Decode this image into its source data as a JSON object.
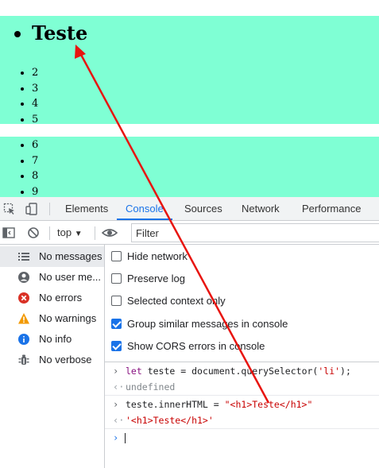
{
  "page": {
    "list1": {
      "big_item": "Teste",
      "items": [
        "2",
        "3",
        "4",
        "5"
      ]
    },
    "list2": {
      "items": [
        "6",
        "7",
        "8",
        "9"
      ]
    },
    "block_color": "#7fffd4"
  },
  "devtools": {
    "tabs": [
      {
        "label": "Elements",
        "active": false
      },
      {
        "label": "Console",
        "active": true
      },
      {
        "label": "Sources",
        "active": false
      },
      {
        "label": "Network",
        "active": false
      },
      {
        "label": "Performance",
        "active": false
      }
    ],
    "toolbar": {
      "context": "top",
      "filter_placeholder": "Filter"
    },
    "sidebar": [
      {
        "label": "No messages",
        "icon": "list-icon",
        "selected": true
      },
      {
        "label": "No user me...",
        "icon": "user-icon",
        "selected": false
      },
      {
        "label": "No errors",
        "icon": "error-icon",
        "selected": false
      },
      {
        "label": "No warnings",
        "icon": "warning-icon",
        "selected": false
      },
      {
        "label": "No info",
        "icon": "info-icon",
        "selected": false
      },
      {
        "label": "No verbose",
        "icon": "bug-icon",
        "selected": false
      }
    ],
    "settings": [
      {
        "label": "Hide network",
        "checked": false
      },
      {
        "label": "Preserve log",
        "checked": false
      },
      {
        "label": "Selected context only",
        "checked": false
      },
      {
        "label": "Group similar messages in console",
        "checked": true
      },
      {
        "label": "Show CORS errors in console",
        "checked": true
      }
    ],
    "console": {
      "line1": {
        "kw": "let",
        "rest": " teste = document.querySelector(",
        "str": "'li'",
        "end": ");"
      },
      "result1": "undefined",
      "line2": {
        "code": "teste.innerHTML = ",
        "str": "\"<h1>Teste</h1>\""
      },
      "result2": "'<h1>Teste</h1>'"
    },
    "accent": "#1a73e8"
  },
  "annotation": {
    "arrow_color": "#e8140f"
  }
}
